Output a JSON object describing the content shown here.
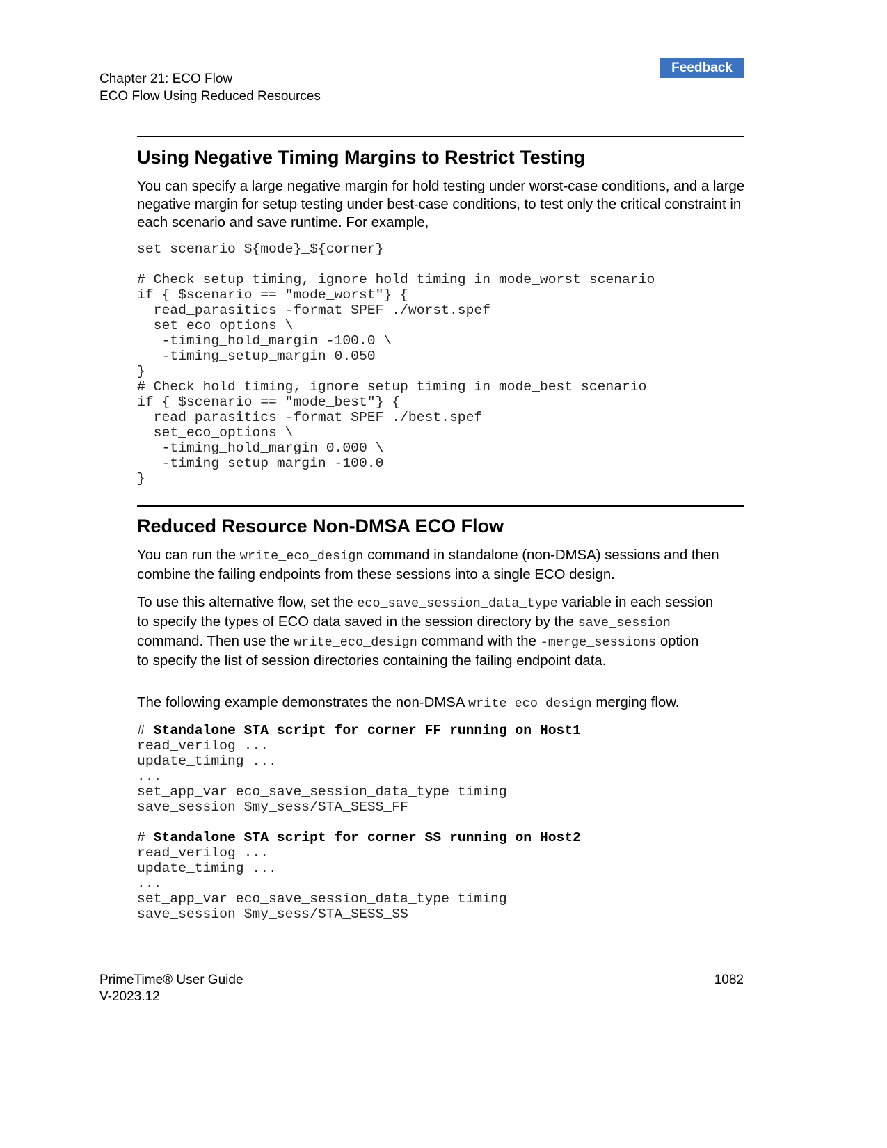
{
  "header": {
    "chapter": "Chapter 21: ECO Flow",
    "section": "ECO Flow Using Reduced Resources",
    "feedback_label": "Feedback",
    "feedback_color": "#3b73c0"
  },
  "section1": {
    "title": "Using Negative Timing Margins to Restrict Testing",
    "para": "You can specify a large negative margin for hold testing under worst-case conditions, and a large negative margin for setup testing under best-case conditions, to test only the critical constraint in each scenario and save runtime. For example,",
    "code": "set scenario ${mode}_${corner}\n\n# Check setup timing, ignore hold timing in mode_worst scenario\nif { $scenario == \"mode_worst\"} {\n  read_parasitics -format SPEF ./worst.spef\n  set_eco_options \\\n   -timing_hold_margin -100.0 \\\n   -timing_setup_margin 0.050\n}\n# Check hold timing, ignore setup timing in mode_best scenario\nif { $scenario == \"mode_best\"} {\n  read_parasitics -format SPEF ./best.spef\n  set_eco_options \\\n   -timing_hold_margin 0.000 \\\n   -timing_setup_margin -100.0\n}"
  },
  "section2": {
    "title": "Reduced Resource Non-DMSA ECO Flow",
    "p1": [
      "You can run the ",
      "write_eco_design",
      " command in standalone (non-DMSA) sessions and then combine the failing endpoints from these sessions into a single ECO design."
    ],
    "p2": [
      "To use this alternative flow, set the ",
      "eco_save_session_data_type",
      " variable in each session to specify the types of ECO data saved in the session directory by the ",
      "save_session",
      " command. Then use the ",
      "write_eco_design",
      " command with the ",
      "-merge_sessions",
      " option to specify the list of session directories containing the failing endpoint data."
    ],
    "p3": [
      "The following example demonstrates the non-DMSA ",
      "write_eco_design",
      " merging flow."
    ],
    "code1_comment": "Standalone STA script for corner FF running on Host1",
    "code1": "read_verilog ...\nupdate_timing ...\n...\nset_app_var eco_save_session_data_type timing\nsave_session $my_sess/STA_SESS_FF",
    "code2_comment": "Standalone STA script for corner SS running on Host2",
    "code2": "read_verilog ...\nupdate_timing ...\n...\nset_app_var eco_save_session_data_type timing\nsave_session $my_sess/STA_SESS_SS"
  },
  "footer": {
    "title": "PrimeTime® User Guide",
    "version": "V-2023.12",
    "page": "1082"
  }
}
